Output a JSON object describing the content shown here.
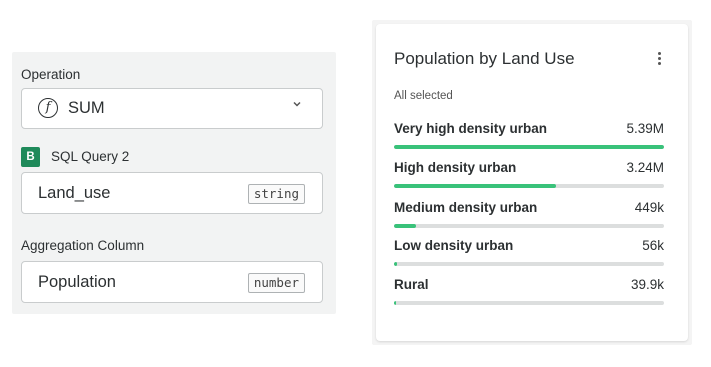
{
  "config": {
    "operation_label": "Operation",
    "operation_value": "SUM",
    "operation_icon": "function-icon",
    "source_badge": "B",
    "source_name": "SQL Query 2",
    "column_name": "Land_use",
    "column_type": "string",
    "aggregation_label": "Aggregation Column",
    "aggregation_name": "Population",
    "aggregation_type": "number"
  },
  "widget": {
    "title": "Population by Land Use",
    "subtitle": "All selected",
    "bar_color": "#39c27a",
    "categories": [
      {
        "name": "Very high density urban",
        "value_label": "5.39M",
        "fraction": 1.0
      },
      {
        "name": "High density urban",
        "value_label": "3.24M",
        "fraction": 0.6
      },
      {
        "name": "Medium density urban",
        "value_label": "449k",
        "fraction": 0.083
      },
      {
        "name": "Low density urban",
        "value_label": "56k",
        "fraction": 0.0104
      },
      {
        "name": "Rural",
        "value_label": "39.9k",
        "fraction": 0.0074
      }
    ]
  }
}
